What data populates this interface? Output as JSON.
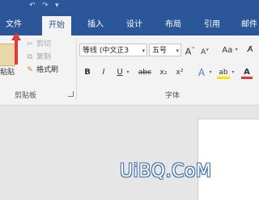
{
  "ribbon_tabs": [
    "文件",
    "开始",
    "插入",
    "设计",
    "布局",
    "引用",
    "邮件"
  ],
  "clipboard": {
    "paste_label": "粘贴",
    "cut_label": "剪切",
    "copy_label": "复制",
    "format_painter_label": "格式刷",
    "group_label": "剪贴板"
  },
  "font": {
    "font_name": "等线 (中文正文)",
    "font_name_display": "等线 (中文正3",
    "font_size": "五号",
    "grow_label": "A",
    "shrink_label": "A",
    "case_label": "Aa",
    "bold_label": "B",
    "italic_label": "I",
    "underline_label": "U",
    "strike_label": "abc",
    "subscript_label": "x₂",
    "superscript_label": "x²",
    "text_effect_label": "A",
    "highlight_label": "ab",
    "font_color_label": "A",
    "group_label": "字体"
  },
  "watermark_text": "UiBQ.CoM",
  "colors": {
    "ribbon_blue": "#2b579a",
    "annotation_arrow": "#e53935",
    "font_color_bar": "#e53935",
    "highlight_bar": "#f5e400"
  }
}
